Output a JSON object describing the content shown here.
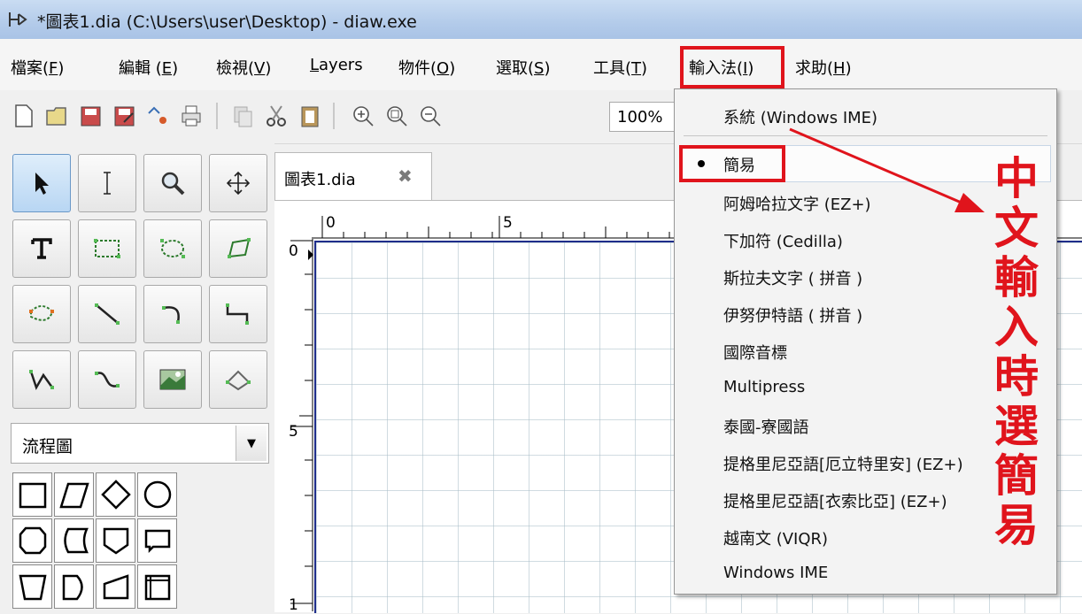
{
  "window": {
    "title": "*圖表1.dia (C:\\Users\\user\\Desktop) - diaw.exe"
  },
  "menubar": [
    {
      "label": "檔案(",
      "mn": "F",
      "end": ")"
    },
    {
      "label": "編輯 (",
      "mn": "E",
      "end": ")"
    },
    {
      "label": "檢視(",
      "mn": "V",
      "end": ")"
    },
    {
      "label": "",
      "mn": "L",
      "end": "ayers"
    },
    {
      "label": "物件(",
      "mn": "O",
      "end": ")"
    },
    {
      "label": "選取(",
      "mn": "S",
      "end": ")"
    },
    {
      "label": "工具(",
      "mn": "T",
      "end": ")"
    },
    {
      "label": "輸入法(",
      "mn": "I",
      "end": ")"
    },
    {
      "label": "求助(",
      "mn": "H",
      "end": ")"
    }
  ],
  "toolbar": {
    "zoom": "100%"
  },
  "toolbox": {
    "sheet": "流程圖"
  },
  "tab": {
    "label": "圖表1.dia"
  },
  "ruler": {
    "h": [
      "0",
      "5"
    ],
    "v": [
      "0",
      "5",
      "1"
    ]
  },
  "ime_menu": {
    "items": [
      "系統 (Windows IME)",
      "簡易",
      "阿姆哈拉文字 (EZ+)",
      "下加符 (Cedilla)",
      "斯拉夫文字 ( 拼音 )",
      "伊努伊特語 ( 拼音 )",
      "國際音標",
      "Multipress",
      "泰國-寮國語",
      "提格里尼亞語[厄立特里安] (EZ+)",
      "提格里尼亞語[衣索比亞] (EZ+)",
      "越南文 (VIQR)",
      "Windows IME"
    ],
    "selected": "簡易"
  },
  "annotation": {
    "text": "中文輸入時選簡易",
    "color": "#e0141c"
  }
}
